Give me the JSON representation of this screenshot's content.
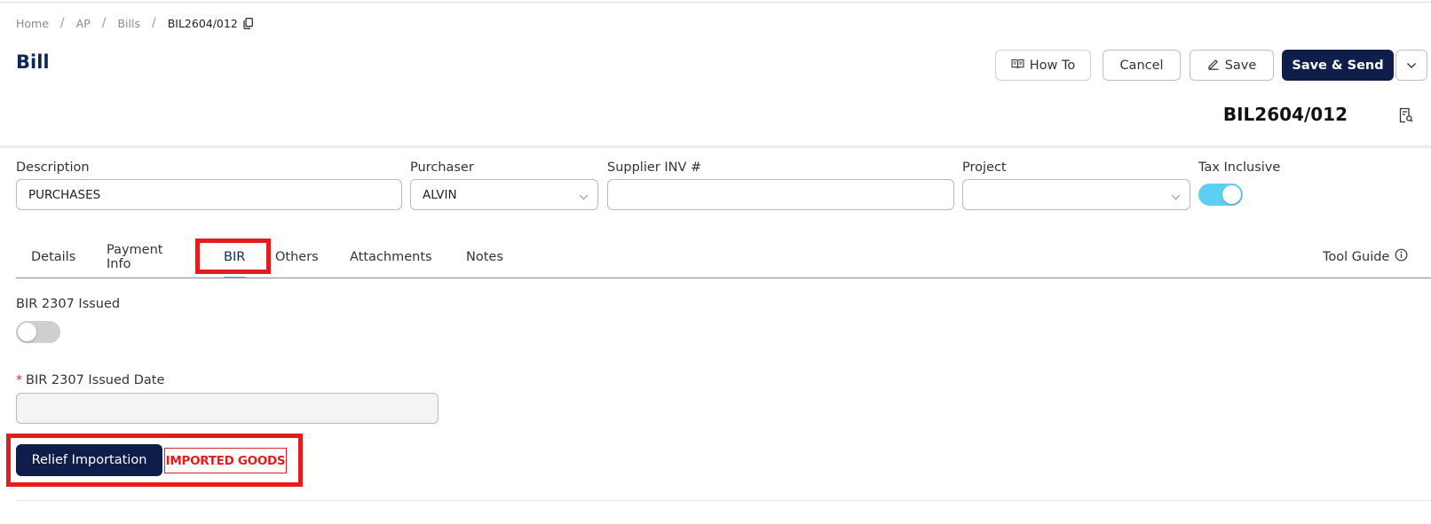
{
  "breadcrumb": {
    "home": "Home",
    "ap": "AP",
    "bills": "Bills",
    "current": "BIL2604/012",
    "separator": "/"
  },
  "page": {
    "title": "Bill",
    "doc_number": "BIL2604/012"
  },
  "toolbar": {
    "how_to_label": "How To",
    "cancel_label": "Cancel",
    "save_label": "Save",
    "save_send_label": "Save & Send"
  },
  "form": {
    "description": {
      "label": "Description",
      "value": "PURCHASES"
    },
    "purchaser": {
      "label": "Purchaser",
      "value": "ALVIN"
    },
    "supplier_inv": {
      "label": "Supplier INV #",
      "value": ""
    },
    "project": {
      "label": "Project",
      "value": ""
    },
    "tax_inclusive": {
      "label": "Tax Inclusive",
      "on": true
    }
  },
  "tabs": {
    "items": [
      "Details",
      "Payment Info",
      "BIR",
      "Others",
      "Attachments",
      "Notes"
    ],
    "active": "BIR",
    "tool_guide": "Tool Guide"
  },
  "bir": {
    "issued_label": "BIR 2307 Issued",
    "issued_on": false,
    "issued_date_label": "BIR 2307 Issued Date",
    "required_mark": "*",
    "issued_date_value": "",
    "relief_button": "Relief Importation",
    "imported_goods": "IMPORTED GOODS"
  },
  "colors": {
    "primary": "#0e1d4a",
    "title": "#0f2757",
    "accent": "#5cd0f2",
    "highlight": "#e51c1c"
  }
}
